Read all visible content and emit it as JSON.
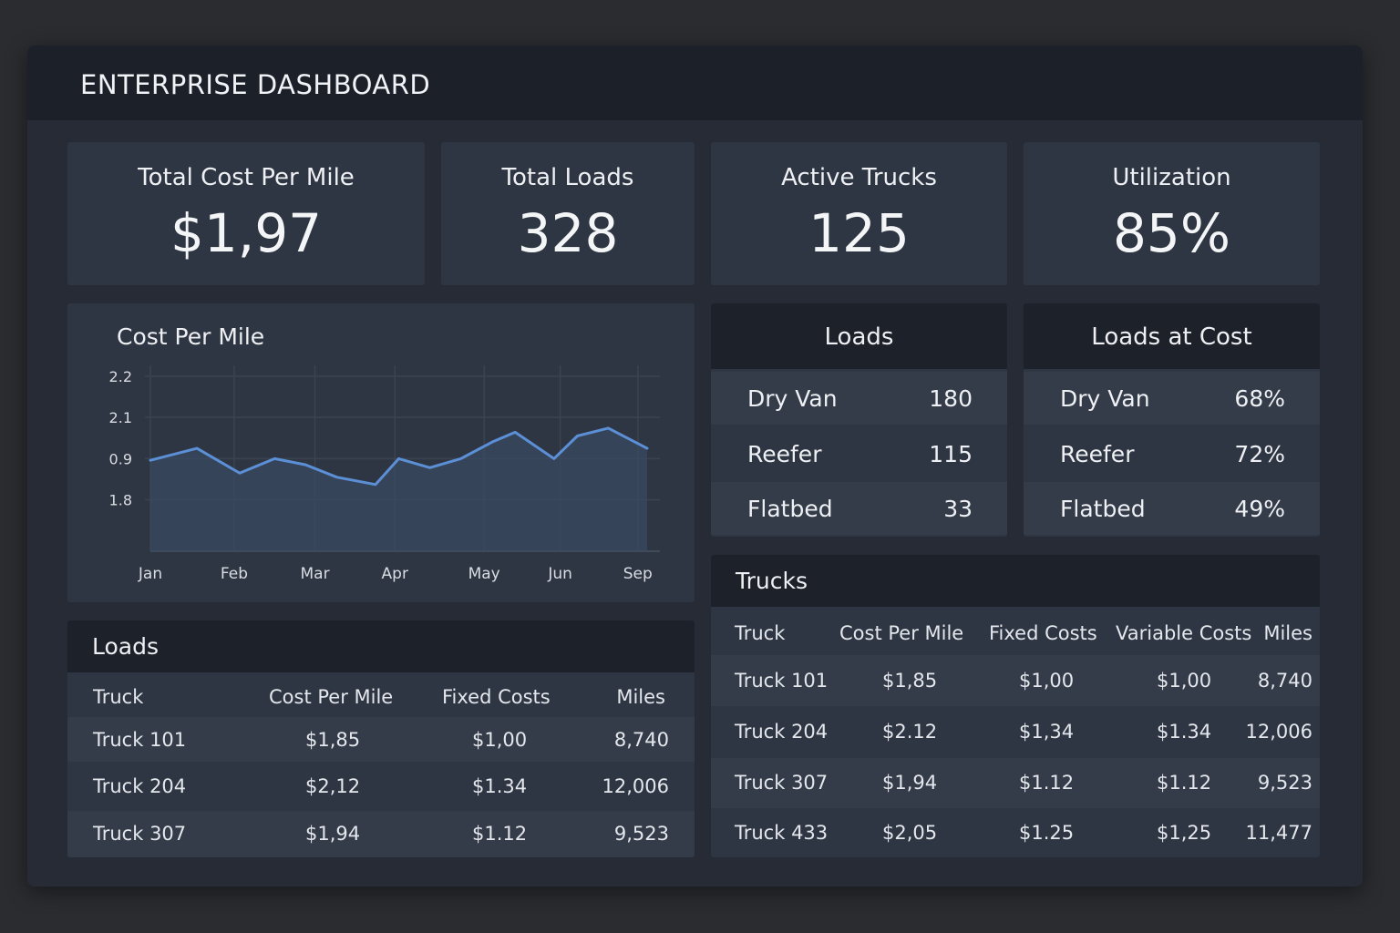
{
  "header": {
    "title": "ENTERPRISE DASHBOARD"
  },
  "kpis": [
    {
      "label": "Total Cost Per Mile",
      "value": "$1,97"
    },
    {
      "label": "Total Loads",
      "value": "328"
    },
    {
      "label": "Active Trucks",
      "value": "125"
    },
    {
      "label": "Utilization",
      "value": "85%"
    }
  ],
  "chart_data": {
    "type": "area",
    "title": "Cost Per Mile",
    "xlabel": "",
    "ylabel": "",
    "y_tick_labels": [
      "2.2",
      "2.1",
      "0.9",
      "1.8"
    ],
    "x_tick_labels": [
      "Jan",
      "Feb",
      "Mar",
      "Apr",
      "May",
      "Jun",
      "Sep"
    ],
    "x_tick_positions": [
      0,
      1.08,
      2.12,
      3.15,
      4.3,
      5.28,
      6.28
    ],
    "y_tick_positions": [
      2.2,
      2.1,
      2.0,
      1.9
    ],
    "ylim": [
      1.775,
      2.2
    ],
    "x": [
      0,
      0.6,
      1.15,
      1.6,
      2.0,
      2.4,
      2.9,
      3.2,
      3.6,
      4.0,
      4.4,
      4.7,
      5.2,
      5.5,
      5.9,
      6.4
    ],
    "values": [
      1.996,
      2.025,
      1.965,
      2.0,
      1.985,
      1.955,
      1.937,
      2.0,
      1.978,
      2.0,
      2.04,
      2.064,
      2.0,
      2.055,
      2.074,
      2.025
    ],
    "color": "#5b8fd6",
    "grid": true
  },
  "loads_summary": {
    "title": "Loads",
    "rows": [
      {
        "name": "Dry Van",
        "value": "180"
      },
      {
        "name": "Reefer",
        "value": "115"
      },
      {
        "name": "Flatbed",
        "value": "33"
      }
    ]
  },
  "loads_at_cost": {
    "title": "Loads at Cost",
    "rows": [
      {
        "name": "Dry Van",
        "value": "68%"
      },
      {
        "name": "Reefer",
        "value": "72%"
      },
      {
        "name": "Flatbed",
        "value": "49%"
      }
    ]
  },
  "loads_table": {
    "title": "Loads",
    "columns": [
      "Truck",
      "Cost Per Mile",
      "Fixed Costs",
      "Miles"
    ],
    "rows": [
      [
        "Truck 101",
        "$1,85",
        "$1,00",
        "8,740"
      ],
      [
        "Truck 204",
        "$2,12",
        "$1.34",
        "12,006"
      ],
      [
        "Truck 307",
        "$1,94",
        "$1.12",
        "9,523"
      ]
    ]
  },
  "trucks_table": {
    "title": "Trucks",
    "columns": [
      "Truck",
      "Cost Per Mile",
      "Fixed Costs",
      "Variable Costs",
      "Miles"
    ],
    "rows": [
      [
        "Truck 101",
        "$1,85",
        "$1,00",
        "$1,00",
        "8,740"
      ],
      [
        "Truck 204",
        "$2.12",
        "$1,34",
        "$1.34",
        "12,006"
      ],
      [
        "Truck 307",
        "$1,94",
        "$1.12",
        "$1.12",
        "9,523"
      ],
      [
        "Truck 433",
        "$2,05",
        "$1.25",
        "$1,25",
        "11,477"
      ]
    ]
  }
}
